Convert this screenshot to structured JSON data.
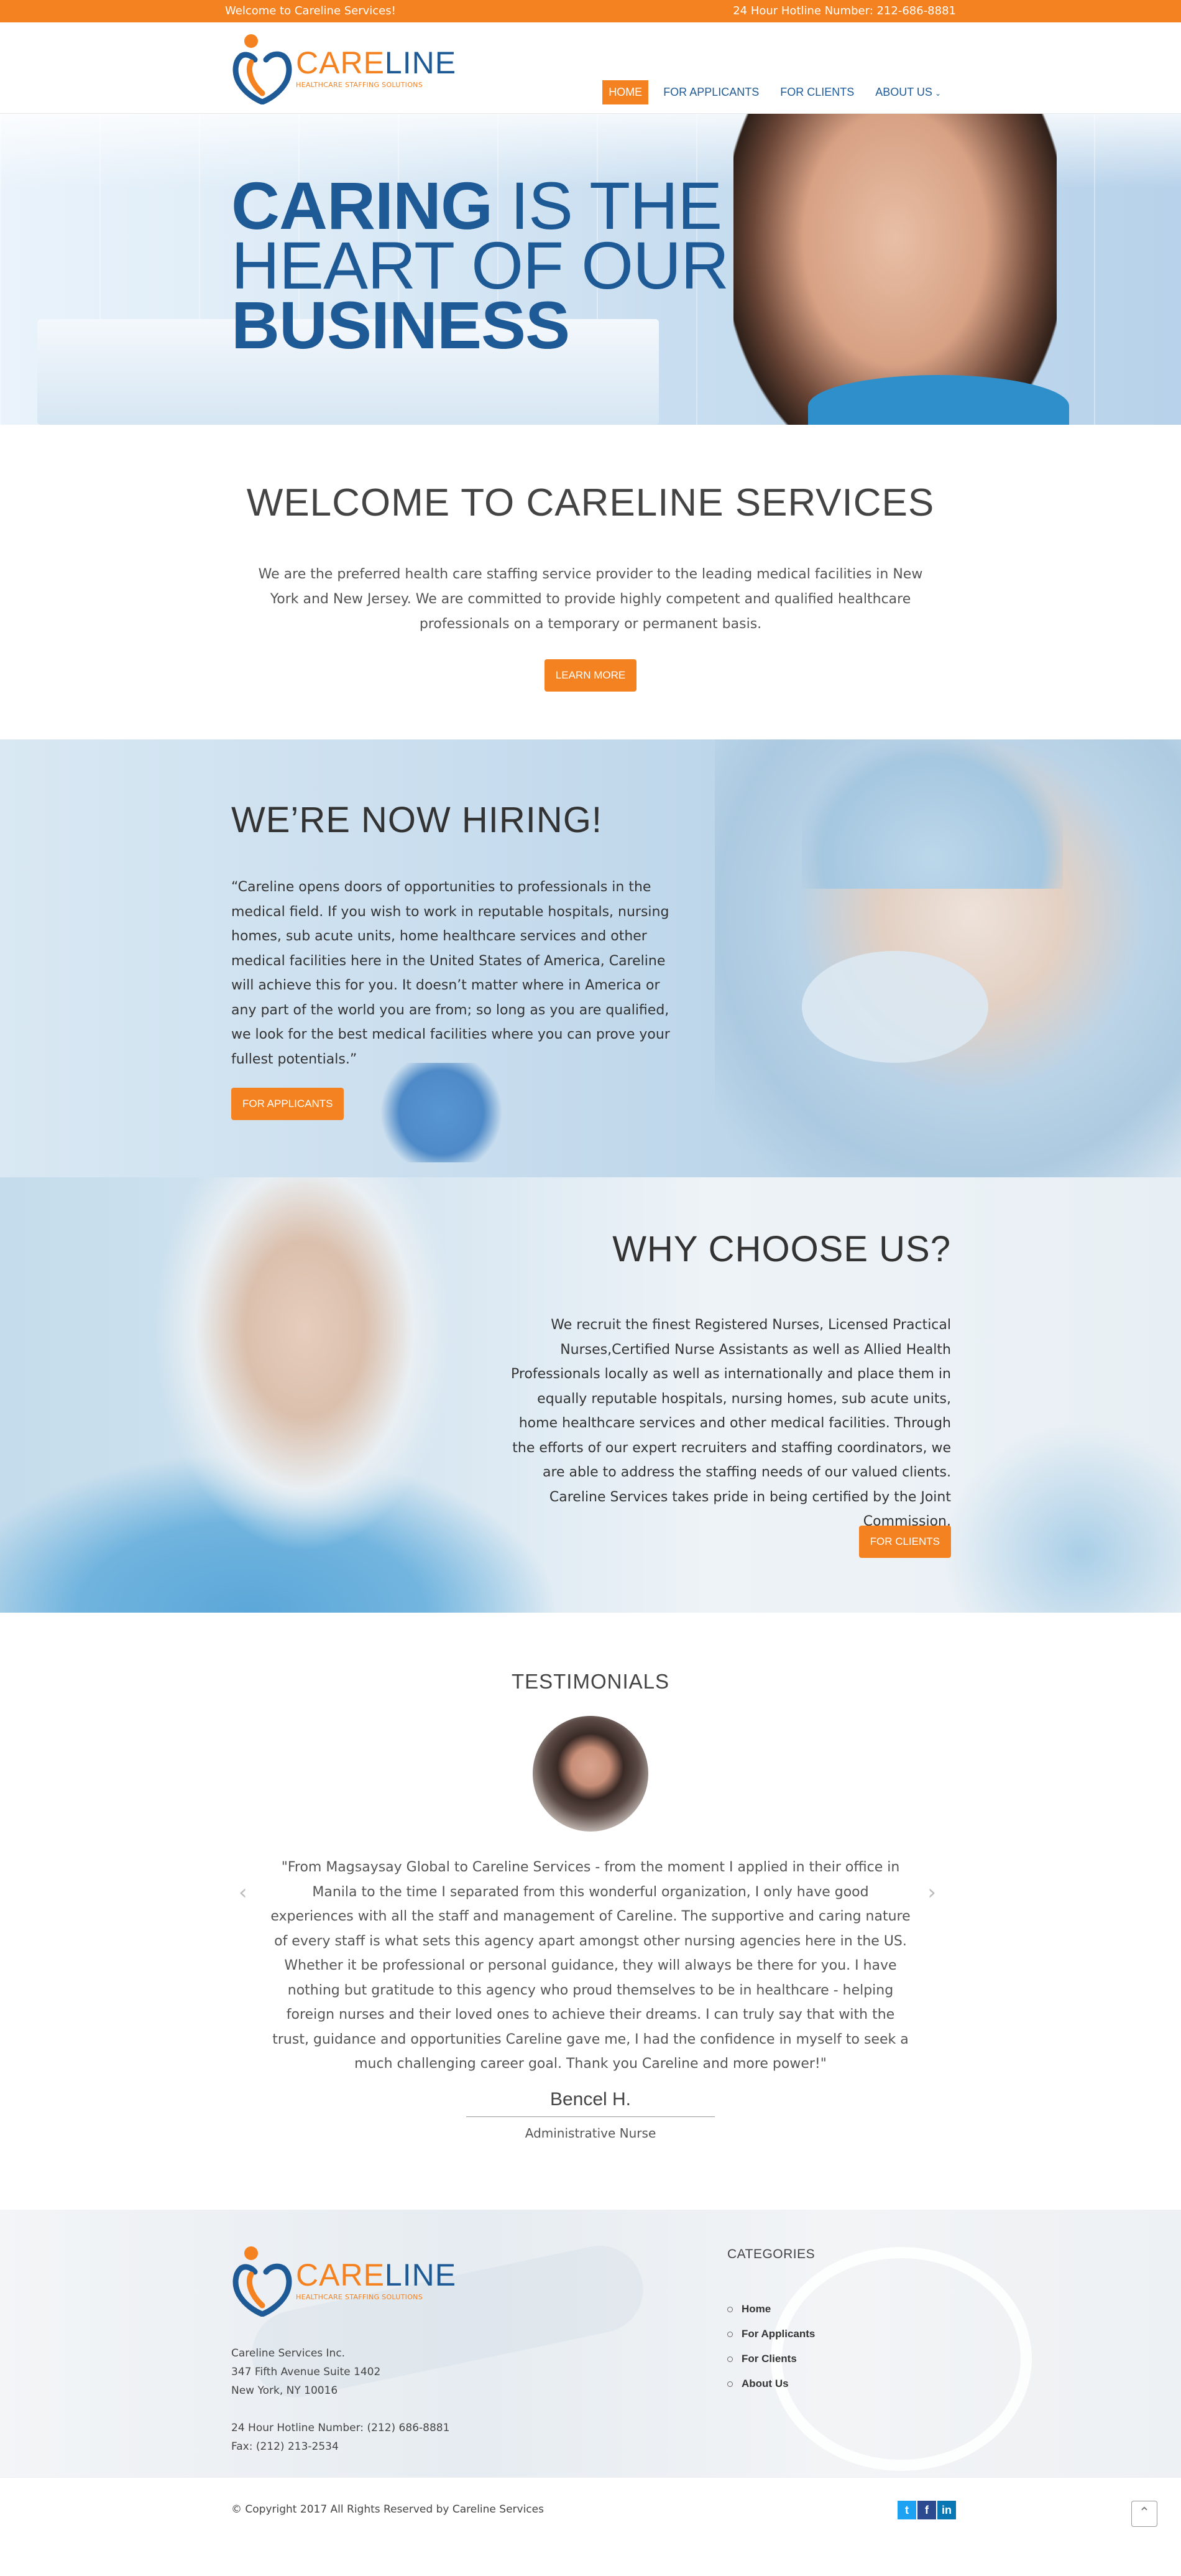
{
  "topbar": {
    "welcome": "Welcome to Careline Services!",
    "hotline": "24 Hour Hotline Number: 212-686-8881"
  },
  "logo": {
    "care": "CARE",
    "line": "LINE",
    "tagline": "HEALTHCARE STAFFING SOLUTIONS"
  },
  "nav": {
    "items": [
      {
        "label": "HOME",
        "active": true
      },
      {
        "label": "FOR APPLICANTS",
        "active": false
      },
      {
        "label": "FOR CLIENTS",
        "active": false
      },
      {
        "label": "ABOUT US",
        "active": false
      }
    ],
    "dropdown_icon": "chevron-down-icon"
  },
  "hero": {
    "line1_bold": "CARING",
    "line1_rest": " IS THE",
    "line2": "HEART OF OUR",
    "line3": "BUSINESS"
  },
  "welcome": {
    "title": "WELCOME TO CARELINE SERVICES",
    "body": "We are the preferred health care staffing service provider to the leading medical facilities in New York and New Jersey. We are committed to provide highly competent and qualified healthcare professionals on a temporary or permanent basis.",
    "button": "LEARN MORE"
  },
  "hiring": {
    "title": "WE’RE NOW HIRING!",
    "body": "“Careline opens doors of opportunities to professionals in the medical field. If you wish to work in reputable hospitals, nursing homes, sub acute units, home healthcare services and other medical facilities here in the United States of America, Careline will achieve this for you. It doesn’t matter where in America or any part of the world you are from; so long as you are qualified, we look for the best medical facilities where you can prove your fullest potentials.”",
    "button": "FOR APPLICANTS"
  },
  "why": {
    "title": "WHY CHOOSE US?",
    "body": "We recruit the finest Registered Nurses, Licensed Practical Nurses,Certified Nurse Assistants as well as Allied Health Professionals locally as well as internationally and place them in equally reputable hospitals, nursing homes, sub acute units, home healthcare services and other medical facilities. Through the efforts of our expert recruiters and staffing coordinators, we are able to address the staffing needs of our valued clients. Careline Services takes pride in being certified by the Joint Commission.",
    "button": "FOR CLIENTS"
  },
  "testimonials": {
    "title": "TESTIMONIALS",
    "quote": "\"From Magsaysay Global to Careline Services - from the moment I applied in their office in Manila to the time I separated from this wonderful organization, I only have good experiences with all the staff and management of Careline. The supportive and caring nature of every staff is what sets this agency apart amongst other nursing agencies here in the US. Whether it be professional or personal guidance, they will always be there for you. I have nothing but gratitude to this agency who proud themselves to be in healthcare - helping foreign nurses and their loved ones to achieve their dreams. I can truly say that with the trust, guidance and opportunities Careline gave me, I had the confidence in myself to seek a much challenging career goal. Thank you Careline and more power!\"",
    "name": "Bencel H.",
    "role": "Administrative Nurse",
    "prev": "‹",
    "next": "›"
  },
  "footer": {
    "address": {
      "company": "Careline Services Inc.",
      "street": "347 Fifth Avenue Suite 1402",
      "city": "New York, NY 10016",
      "hotline": "24 Hour Hotline Number: (212) 686-8881",
      "fax": "Fax: (212) 213-2534"
    },
    "categories_title": "CATEGORIES",
    "categories": [
      "Home",
      "For Applicants",
      "For Clients",
      "About Us"
    ],
    "copyright": "© Copyright 2017 All Rights Reserved by Careline Services",
    "social": {
      "twitter": "t",
      "facebook": "f",
      "linkedin": "in"
    },
    "to_top": "⌃"
  },
  "colors": {
    "accent": "#f58220",
    "brand_blue": "#1e5a96"
  }
}
